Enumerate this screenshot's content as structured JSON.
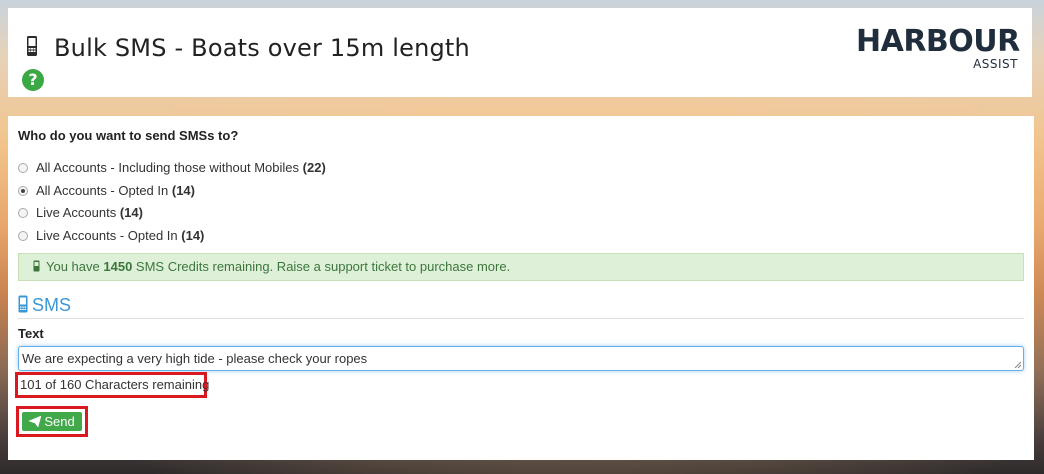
{
  "header": {
    "title": "Bulk SMS - Boats over 15m length",
    "help_icon": "question-circle-icon",
    "logo": {
      "main": "HARBOUR",
      "sub": "ASSIST"
    }
  },
  "form": {
    "question": "Who do you want to send SMSs to?",
    "recipients": [
      {
        "label": "All Accounts - Including those without Mobiles",
        "count": "(22)",
        "checked": false
      },
      {
        "label": "All Accounts - Opted In",
        "count": "(14)",
        "checked": true
      },
      {
        "label": "Live Accounts",
        "count": "(14)",
        "checked": false
      },
      {
        "label": "Live Accounts - Opted In",
        "count": "(14)",
        "checked": false
      }
    ],
    "credits": {
      "prefix": "You have",
      "amount": "1450",
      "suffix": "SMS Credits remaining. Raise a support ticket to purchase more."
    },
    "sms_section_title": "SMS",
    "text_label": "Text",
    "message": "We are expecting a very high tide - please check your ropes",
    "counter": "101 of 160 Characters remaining",
    "send_label": "Send"
  },
  "colors": {
    "accent_blue": "#3a97d6",
    "success_green": "#41a949",
    "alert_green_bg": "#dff0d8",
    "highlight_red": "#d9181f"
  }
}
